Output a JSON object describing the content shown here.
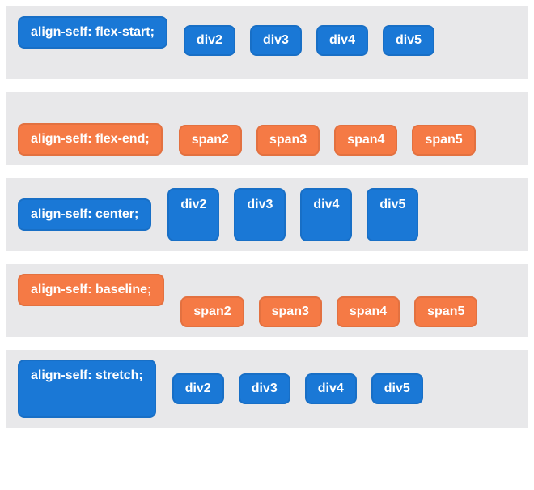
{
  "examples": [
    {
      "label": "align-self: flex-start;",
      "color": "blue",
      "child_prefix": "div",
      "child_color": "blue",
      "children": [
        "div2",
        "div3",
        "div4",
        "div5"
      ],
      "align_class": "flex-start"
    },
    {
      "label": "align-self: flex-end;",
      "color": "orange",
      "child_prefix": "span",
      "child_color": "orange",
      "children": [
        "span2",
        "span3",
        "span4",
        "span5"
      ],
      "align_class": "flex-end"
    },
    {
      "label": "align-self: center;",
      "color": "blue",
      "child_prefix": "div",
      "child_color": "blue",
      "children": [
        "div2",
        "div3",
        "div4",
        "div5"
      ],
      "align_class": "center"
    },
    {
      "label": "align-self: baseline;",
      "color": "orange",
      "child_prefix": "span",
      "child_color": "orange",
      "children": [
        "span2",
        "span3",
        "span4",
        "span5"
      ],
      "align_class": "baseline"
    },
    {
      "label": "align-self: stretch;",
      "color": "blue",
      "child_prefix": "div",
      "child_color": "blue",
      "children": [
        "div2",
        "div3",
        "div4",
        "div5"
      ],
      "align_class": "stretch"
    }
  ]
}
